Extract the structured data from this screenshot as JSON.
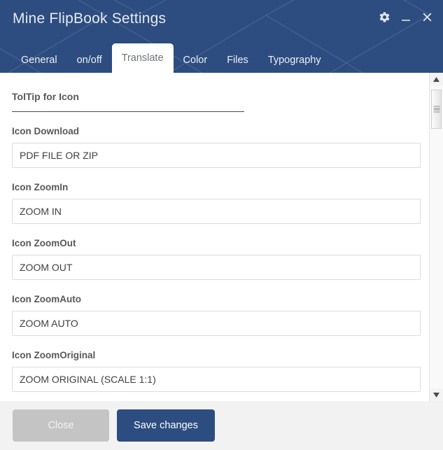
{
  "window": {
    "title": "Mine FlipBook Settings",
    "header_color": "#2d4d80",
    "controls": [
      {
        "name": "settings-gear",
        "icon": "gear-icon",
        "label": "Settings"
      },
      {
        "name": "minimize",
        "icon": "minimize-icon",
        "label": "Minimize"
      },
      {
        "name": "close",
        "icon": "close-icon",
        "label": "Close"
      }
    ]
  },
  "tabs": [
    {
      "label": "General",
      "active": false
    },
    {
      "label": "on/off",
      "active": false
    },
    {
      "label": "Translate",
      "active": true
    },
    {
      "label": "Color",
      "active": false
    },
    {
      "label": "Files",
      "active": false
    },
    {
      "label": "Typography",
      "active": false
    }
  ],
  "content": {
    "section_title": "TolTip for Icon",
    "fields": [
      {
        "label": "Icon Download",
        "value": "PDF FILE OR ZIP",
        "placeholder": ""
      },
      {
        "label": "Icon ZoomIn",
        "value": "ZOOM IN",
        "placeholder": ""
      },
      {
        "label": "Icon ZoomOut",
        "value": "ZOOM OUT",
        "placeholder": ""
      },
      {
        "label": "Icon ZoomAuto",
        "value": "ZOOM AUTO",
        "placeholder": ""
      },
      {
        "label": "Icon ZoomOriginal",
        "value": "ZOOM ORIGINAL (SCALE 1:1)",
        "placeholder": ""
      }
    ]
  },
  "scrollbar": {
    "up_arrow": "▲",
    "down_arrow": "▼",
    "thumb_position_pct": 2
  },
  "footer": {
    "close_label": "Close",
    "save_label": "Save changes",
    "close_color": "#c4c4c4",
    "save_color": "#2d4d80"
  }
}
